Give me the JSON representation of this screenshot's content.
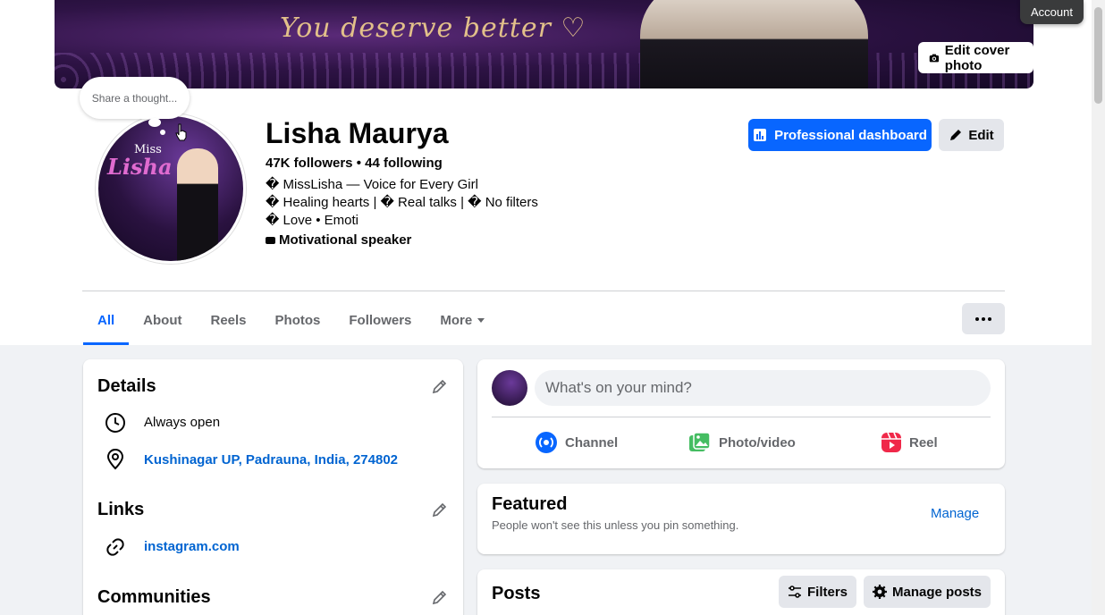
{
  "cover": {
    "tagline": "You deserve better ♡",
    "edit_label": "Edit cover photo"
  },
  "account_label": "Account",
  "thought_bubble": "Share a thought...",
  "avatar": {
    "miss": "Miss",
    "lisha": "Lisha"
  },
  "profile": {
    "name": "Lisha Maurya",
    "followers": "47K followers • 44 following",
    "bio": [
      "� MissLisha — Voice for Every Girl",
      "� Healing hearts | � Real talks | � No filters",
      "� Love • Emoti"
    ],
    "category": "Motivational speaker"
  },
  "actions": {
    "professional_dashboard": "Professional dashboard",
    "edit": "Edit"
  },
  "tabs": [
    {
      "label": "All",
      "active": true
    },
    {
      "label": "About",
      "active": false
    },
    {
      "label": "Reels",
      "active": false
    },
    {
      "label": "Photos",
      "active": false
    },
    {
      "label": "Followers",
      "active": false
    },
    {
      "label": "More",
      "active": false
    }
  ],
  "details": {
    "title": "Details",
    "hours": "Always open",
    "location": "Kushinagar UP, Padrauna, India, 274802"
  },
  "links": {
    "title": "Links",
    "instagram": "instagram.com"
  },
  "communities": {
    "title": "Communities"
  },
  "composer": {
    "placeholder": "What's on your mind?",
    "channel": "Channel",
    "photo_video": "Photo/video",
    "reel": "Reel"
  },
  "featured": {
    "title": "Featured",
    "subtitle": "People won't see this unless you pin something.",
    "manage": "Manage"
  },
  "posts": {
    "title": "Posts",
    "filters": "Filters",
    "manage_posts": "Manage posts"
  },
  "colors": {
    "accent": "#0866ff",
    "link": "#0064d1",
    "page_bg": "#f0f2f5"
  }
}
